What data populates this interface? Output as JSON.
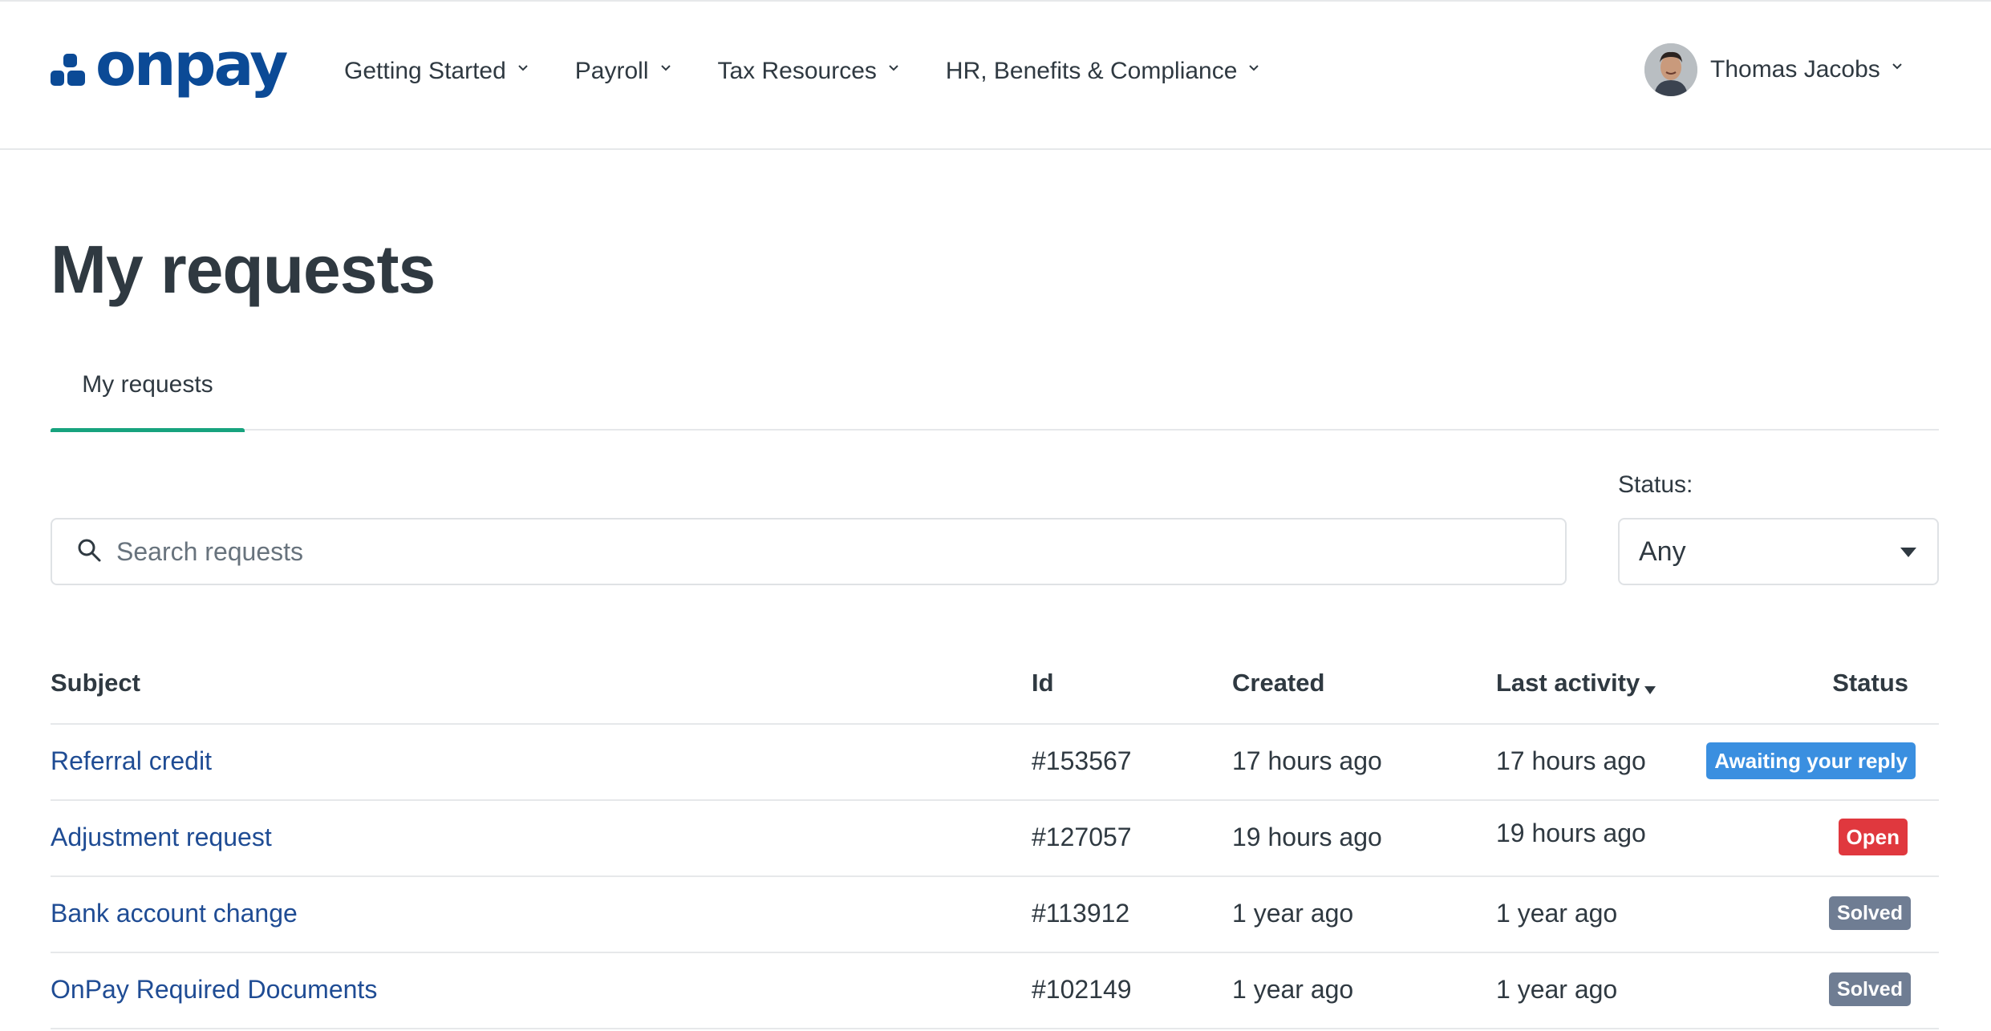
{
  "header": {
    "logo_text": "onpay",
    "nav": [
      {
        "label": "Getting Started"
      },
      {
        "label": "Payroll"
      },
      {
        "label": "Tax Resources"
      },
      {
        "label": "HR, Benefits & Compliance"
      }
    ],
    "user_name": "Thomas Jacobs"
  },
  "page": {
    "title": "My requests",
    "tabs": [
      {
        "label": "My requests"
      }
    ]
  },
  "search": {
    "placeholder": "Search requests",
    "value": ""
  },
  "status_filter": {
    "label": "Status:",
    "selected": "Any"
  },
  "table": {
    "columns": [
      "Subject",
      "Id",
      "Created",
      "Last activity",
      "Status"
    ],
    "sorted_by": "Last activity",
    "rows": [
      {
        "subject": "Referral credit",
        "id": "#153567",
        "created": "17 hours ago",
        "last_activity": "17 hours ago",
        "status": "Awaiting your reply",
        "status_color": "#3a8fe0"
      },
      {
        "subject": "Adjustment request",
        "id": "#127057",
        "created": "19 hours ago",
        "last_activity": "19 hours ago",
        "status": "Open",
        "status_color": "#e0383e"
      },
      {
        "subject": "Bank account change",
        "id": "#113912",
        "created": "1 year ago",
        "last_activity": "1 year ago",
        "status": "Solved",
        "status_color": "#6f7d93"
      },
      {
        "subject": "OnPay Required Documents",
        "id": "#102149",
        "created": "1 year ago",
        "last_activity": "1 year ago",
        "status": "Solved",
        "status_color": "#6f7d93"
      }
    ]
  },
  "colors": {
    "brand": "#0b4a96",
    "link": "#1f4c94",
    "tab_indicator": "#17a37e",
    "text": "#2f3941"
  }
}
